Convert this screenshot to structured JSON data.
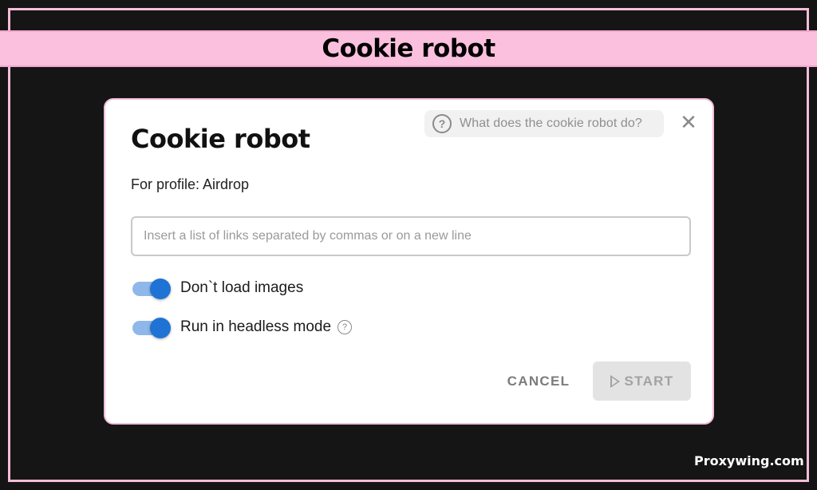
{
  "banner": {
    "title": "Cookie robot"
  },
  "dialog": {
    "title": "Cookie robot",
    "profile_text": "For profile: Airdrop",
    "help_link": "What does the cookie robot do?",
    "close_icon": "close-icon",
    "links_input": {
      "value": "",
      "placeholder": "Insert a list of links separated by commas or on a new line"
    },
    "toggles": [
      {
        "label": "Don`t load images",
        "on": true
      },
      {
        "label": "Run in headless mode",
        "on": true
      }
    ],
    "cancel_label": "CANCEL",
    "start_label": "START",
    "start_enabled": false
  },
  "colors": {
    "accent": "#1e73d4",
    "banner": "#fbc0de",
    "frame": "#f5bcd9",
    "background": "#141414"
  },
  "watermark": "Proxywing.com"
}
